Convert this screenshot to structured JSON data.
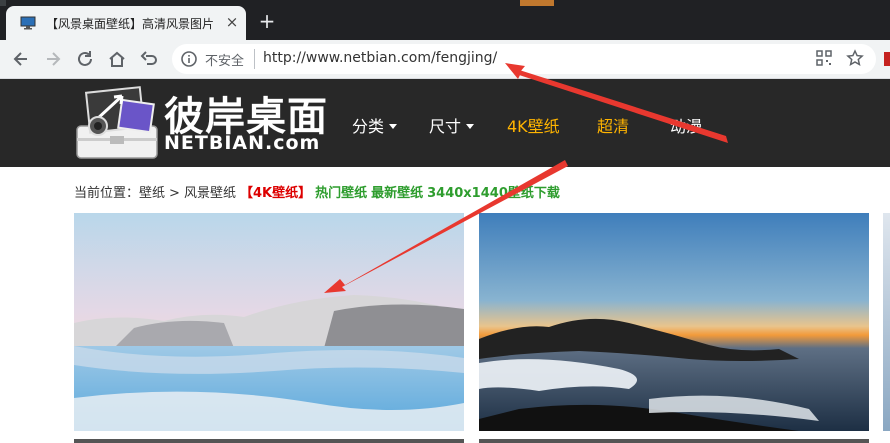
{
  "browser": {
    "tab_title": "【风景桌面壁纸】高清风景图片",
    "tab_close": "×",
    "new_tab": "+",
    "security_label": "不安全",
    "url": "http://www.netbian.com/fengjing/",
    "colors": {
      "chrome_dark": "#202124",
      "toolbar": "#f1f3f4",
      "tab_accent": "#c0782e"
    }
  },
  "site": {
    "logo_cn": "彼岸桌面",
    "logo_en": "NETBIAN.com",
    "nav": [
      {
        "label": "分类",
        "dropdown": true
      },
      {
        "label": "尺寸",
        "dropdown": true
      },
      {
        "label": "4K壁纸",
        "highlight": true
      },
      {
        "label": "超清",
        "highlight": true
      },
      {
        "label": "动漫"
      }
    ],
    "colors": {
      "header_bg": "#282828",
      "highlight": "#ffb400"
    }
  },
  "breadcrumb": {
    "prefix": "当前位置：",
    "home": "壁纸",
    "separator": ">",
    "current": "风景壁纸",
    "tag_4k": "【4K壁纸】",
    "links": [
      "热门壁纸",
      "最新壁纸",
      "3440x1440壁纸下载"
    ]
  },
  "gallery": {
    "items": [
      {
        "name": "pastel-dunes-reflection"
      },
      {
        "name": "sunset-sea-clouds"
      }
    ]
  },
  "annotation": {
    "color": "#e8382f",
    "arrows": 2
  }
}
